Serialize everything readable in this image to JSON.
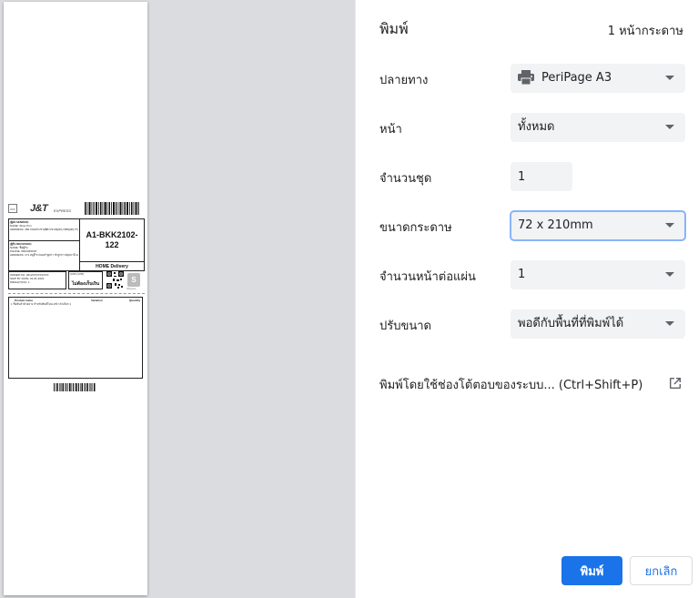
{
  "dialog": {
    "title": "พิมพ์",
    "sheet_count": "1 หน้ากระดาษ"
  },
  "settings": {
    "destination": {
      "label": "ปลายทาง",
      "value": "PeriPage A3",
      "icon": "printer-icon"
    },
    "pages": {
      "label": "หน้า",
      "value": "ทั้งหมด"
    },
    "copies": {
      "label": "จำนวนชุด",
      "value": "1"
    },
    "paper_size": {
      "label": "ขนาดกระดาษ",
      "value": "72 x 210mm"
    },
    "pages_per_sheet": {
      "label": "จำนวนหน้าต่อแผ่น",
      "value": "1"
    },
    "scale": {
      "label": "ปรับขนาด",
      "value": "พอดีกับพื้นที่ที่พิมพ์ได้"
    }
  },
  "system_dialog": {
    "label": "พิมพ์โดยใช้ช่องโต้ตอบของระบบ... (Ctrl+Shift+P)",
    "icon": "open-external-icon"
  },
  "buttons": {
    "print": "พิมพ์",
    "cancel": "ยกเลิก"
  },
  "colors": {
    "accent": "#1a73e8",
    "preview_bg": "#dadce0",
    "select_bg": "#f1f3f4",
    "focus_ring": "#8ab4f8"
  },
  "preview": {
    "off_badge": "OFF",
    "logo": "J&T",
    "logo_suffix": "EXPRESS",
    "sort_code": "A1-BKK2102-122",
    "home_delivery": "HOME Delivery",
    "sender_title": "(ผู้ส่ง SENDER)",
    "sender_line1": "NAME: Shop Prin",
    "sender_line2": "ADDRESS: 460 ถนนประชาอุทิศ แขวงทุ่งครุ เขตทุ่งครุ กรุงเทพมหานคร 10140",
    "receiver_title": "(ผู้รับ RECEIVER)",
    "receiver_line1": "NAME: ชื่อผู้รับ",
    "receiver_line2": "PHONE: 0812345678",
    "receiver_line3": "ADDRESS: 171 หมู่ที่ 5 ถนนลำลูกกา ลำลูกกา ปทุมธานี 12150",
    "order_line1": "ORDER NO: 2012XXXXXXXXX",
    "order_line2": "SHIP BY DATE: 01-01-2021",
    "order_line3": "WEIGHT(KG): 1",
    "cod_title": "COD (บาท)",
    "cod_value": "ไม่ต้องเก็บเงิน",
    "shopee_text": "Shopee",
    "items_col_product": "Product name",
    "items_col_variation": "Variation",
    "items_col_qty": "Quantity",
    "item_row": "1  ชื่อสินค้าตัวอย่าง สำหรับพิมพ์ใบปะหน้า                    ตัวเลือก          1"
  }
}
